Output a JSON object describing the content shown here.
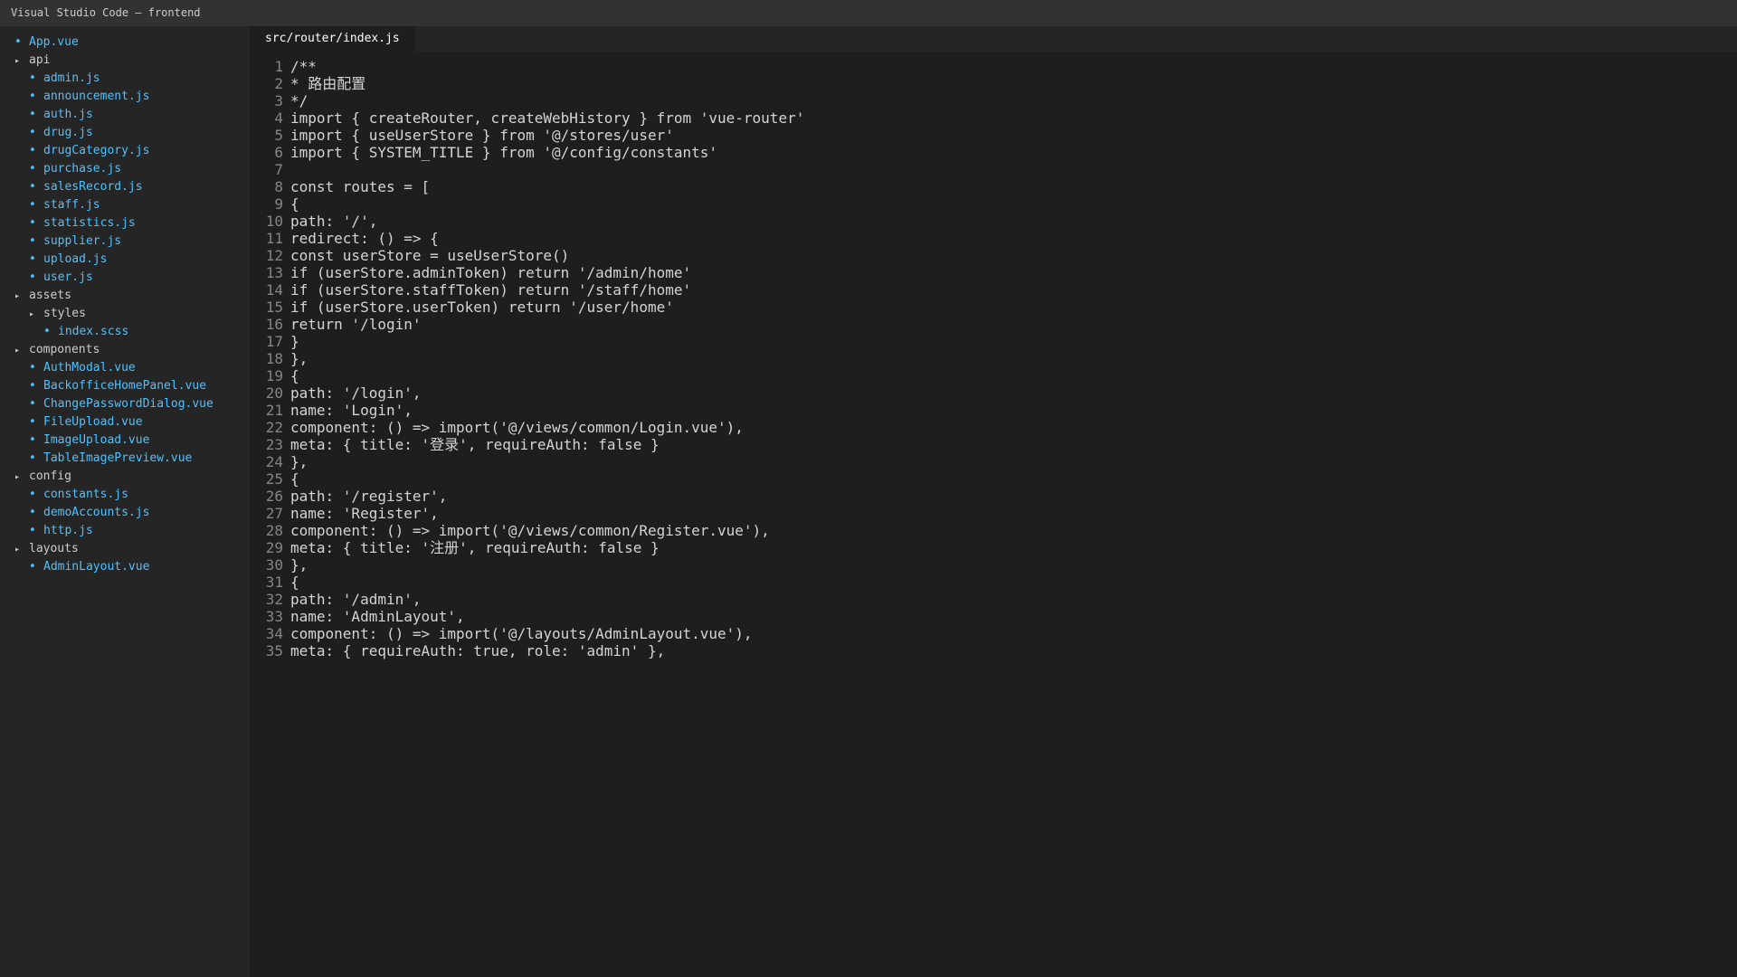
{
  "window": {
    "title": "Visual Studio Code — frontend"
  },
  "explorer": {
    "items": [
      {
        "type": "file",
        "depth": 0,
        "label": "App.vue",
        "name": "app-vue"
      },
      {
        "type": "folder",
        "depth": 0,
        "label": "api",
        "name": "api"
      },
      {
        "type": "file",
        "depth": 1,
        "label": "admin.js",
        "name": "admin-js"
      },
      {
        "type": "file",
        "depth": 1,
        "label": "announcement.js",
        "name": "announcement-js"
      },
      {
        "type": "file",
        "depth": 1,
        "label": "auth.js",
        "name": "auth-js"
      },
      {
        "type": "file",
        "depth": 1,
        "label": "drug.js",
        "name": "drug-js"
      },
      {
        "type": "file",
        "depth": 1,
        "label": "drugCategory.js",
        "name": "drugcategory-js"
      },
      {
        "type": "file",
        "depth": 1,
        "label": "purchase.js",
        "name": "purchase-js"
      },
      {
        "type": "file",
        "depth": 1,
        "label": "salesRecord.js",
        "name": "salesrecord-js"
      },
      {
        "type": "file",
        "depth": 1,
        "label": "staff.js",
        "name": "staff-js"
      },
      {
        "type": "file",
        "depth": 1,
        "label": "statistics.js",
        "name": "statistics-js"
      },
      {
        "type": "file",
        "depth": 1,
        "label": "supplier.js",
        "name": "supplier-js"
      },
      {
        "type": "file",
        "depth": 1,
        "label": "upload.js",
        "name": "upload-js"
      },
      {
        "type": "file",
        "depth": 1,
        "label": "user.js",
        "name": "user-js"
      },
      {
        "type": "folder",
        "depth": 0,
        "label": "assets",
        "name": "assets"
      },
      {
        "type": "folder",
        "depth": 1,
        "label": "styles",
        "name": "styles"
      },
      {
        "type": "file",
        "depth": 2,
        "label": "index.scss",
        "name": "index-scss"
      },
      {
        "type": "folder",
        "depth": 0,
        "label": "components",
        "name": "components"
      },
      {
        "type": "file",
        "depth": 1,
        "label": "AuthModal.vue",
        "name": "authmodal-vue"
      },
      {
        "type": "file",
        "depth": 1,
        "label": "BackofficeHomePanel.vue",
        "name": "backofficehomepanel-vue"
      },
      {
        "type": "file",
        "depth": 1,
        "label": "ChangePasswordDialog.vue",
        "name": "changepassworddialog-vue"
      },
      {
        "type": "file",
        "depth": 1,
        "label": "FileUpload.vue",
        "name": "fileupload-vue"
      },
      {
        "type": "file",
        "depth": 1,
        "label": "ImageUpload.vue",
        "name": "imageupload-vue"
      },
      {
        "type": "file",
        "depth": 1,
        "label": "TableImagePreview.vue",
        "name": "tableimagepreview-vue"
      },
      {
        "type": "folder",
        "depth": 0,
        "label": "config",
        "name": "config"
      },
      {
        "type": "file",
        "depth": 1,
        "label": "constants.js",
        "name": "constants-js"
      },
      {
        "type": "file",
        "depth": 1,
        "label": "demoAccounts.js",
        "name": "demoaccounts-js"
      },
      {
        "type": "file",
        "depth": 1,
        "label": "http.js",
        "name": "http-js"
      },
      {
        "type": "folder",
        "depth": 0,
        "label": "layouts",
        "name": "layouts"
      },
      {
        "type": "file",
        "depth": 1,
        "label": "AdminLayout.vue",
        "name": "adminlayout-vue"
      }
    ]
  },
  "editor": {
    "tab_label": "src/router/index.js",
    "lines": [
      {
        "num": "1",
        "text": "/**"
      },
      {
        "num": "2",
        "text": "* 路由配置"
      },
      {
        "num": "3",
        "text": "*/"
      },
      {
        "num": "4",
        "text": "import { createRouter, createWebHistory } from 'vue-router'"
      },
      {
        "num": "5",
        "text": "import { useUserStore } from '@/stores/user'"
      },
      {
        "num": "6",
        "text": "import { SYSTEM_TITLE } from '@/config/constants'"
      },
      {
        "num": "7",
        "text": ""
      },
      {
        "num": "8",
        "text": "const routes = ["
      },
      {
        "num": "9",
        "text": "{"
      },
      {
        "num": "10",
        "text": "path: '/',"
      },
      {
        "num": "11",
        "text": "redirect: () => {"
      },
      {
        "num": "12",
        "text": "const userStore = useUserStore()"
      },
      {
        "num": "13",
        "text": "if (userStore.adminToken) return '/admin/home'"
      },
      {
        "num": "14",
        "text": "if (userStore.staffToken) return '/staff/home'"
      },
      {
        "num": "15",
        "text": "if (userStore.userToken) return '/user/home'"
      },
      {
        "num": "16",
        "text": "return '/login'"
      },
      {
        "num": "17",
        "text": "}"
      },
      {
        "num": "18",
        "text": "},"
      },
      {
        "num": "19",
        "text": "{"
      },
      {
        "num": "20",
        "text": "path: '/login',"
      },
      {
        "num": "21",
        "text": "name: 'Login',"
      },
      {
        "num": "22",
        "text": "component: () => import('@/views/common/Login.vue'),"
      },
      {
        "num": "23",
        "text": "meta: { title: '登录', requireAuth: false }"
      },
      {
        "num": "24",
        "text": "},"
      },
      {
        "num": "25",
        "text": "{"
      },
      {
        "num": "26",
        "text": "path: '/register',"
      },
      {
        "num": "27",
        "text": "name: 'Register',"
      },
      {
        "num": "28",
        "text": "component: () => import('@/views/common/Register.vue'),"
      },
      {
        "num": "29",
        "text": "meta: { title: '注册', requireAuth: false }"
      },
      {
        "num": "30",
        "text": "},"
      },
      {
        "num": "31",
        "text": "{"
      },
      {
        "num": "32",
        "text": "path: '/admin',"
      },
      {
        "num": "33",
        "text": "name: 'AdminLayout',"
      },
      {
        "num": "34",
        "text": "component: () => import('@/layouts/AdminLayout.vue'),"
      },
      {
        "num": "35",
        "text": "meta: { requireAuth: true, role: 'admin' },"
      }
    ]
  },
  "glyphs": {
    "file": "•",
    "folder": "▸"
  }
}
